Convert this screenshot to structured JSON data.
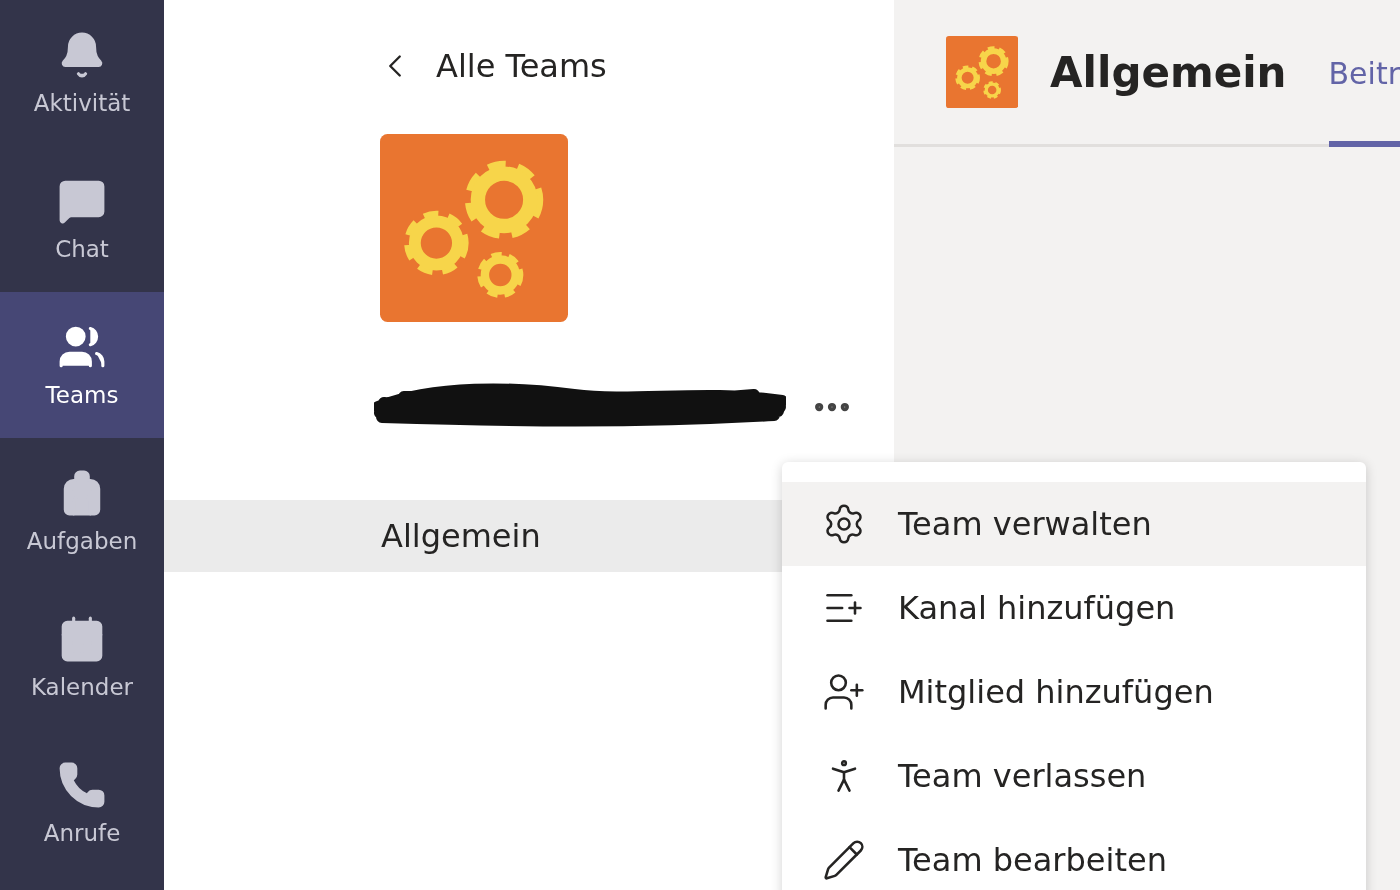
{
  "rail": {
    "items": [
      {
        "kind": "activity",
        "label": "Aktivität",
        "selected": false
      },
      {
        "kind": "chat",
        "label": "Chat",
        "selected": false
      },
      {
        "kind": "teams",
        "label": "Teams",
        "selected": true
      },
      {
        "kind": "tasks",
        "label": "Aufgaben",
        "selected": false
      },
      {
        "kind": "calendar",
        "label": "Kalender",
        "selected": false
      },
      {
        "kind": "calls",
        "label": "Anrufe",
        "selected": false
      }
    ]
  },
  "panel": {
    "back_label": "Alle Teams",
    "channels": [
      {
        "label": "Allgemein",
        "selected": true
      }
    ]
  },
  "channel_header": {
    "title": "Allgemein",
    "tabs": [
      {
        "label": "Beitr",
        "selected": true
      }
    ]
  },
  "menu": {
    "items": [
      {
        "kind": "settings",
        "label": "Team verwalten",
        "selected": true
      },
      {
        "kind": "channel",
        "label": "Kanal hinzufügen",
        "selected": false
      },
      {
        "kind": "member",
        "label": "Mitglied hinzufügen",
        "selected": false
      },
      {
        "kind": "leave",
        "label": "Team verlassen",
        "selected": false
      },
      {
        "kind": "edit",
        "label": "Team bearbeiten",
        "selected": false
      }
    ]
  }
}
